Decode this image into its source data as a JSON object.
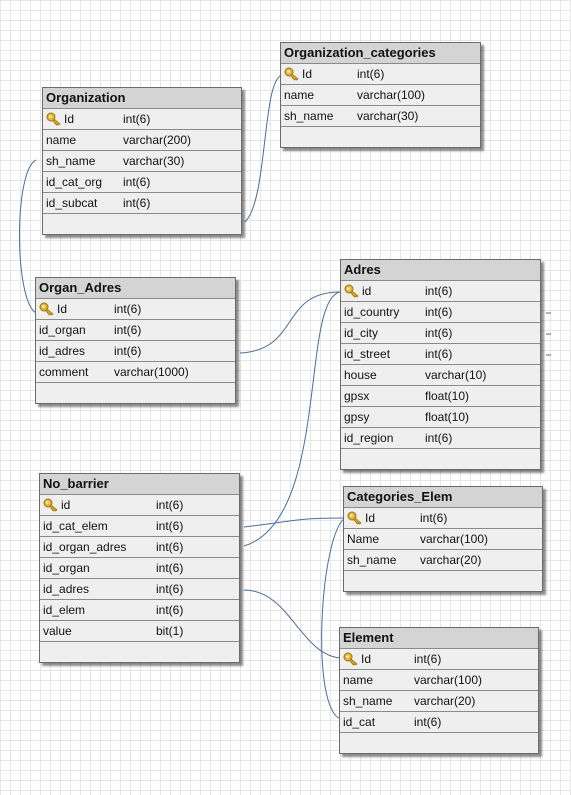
{
  "diagram": {
    "tables": [
      {
        "id": "organization",
        "title": "Organization",
        "columns": [
          {
            "name": "Id",
            "type": "int(6)",
            "pk": true
          },
          {
            "name": "name",
            "type": "varchar(200)"
          },
          {
            "name": "sh_name",
            "type": "varchar(30)"
          },
          {
            "name": "id_cat_org",
            "type": "int(6)"
          },
          {
            "name": "id_subcat",
            "type": "int(6)"
          }
        ]
      },
      {
        "id": "organization-categories",
        "title": "Organization_categories",
        "columns": [
          {
            "name": "Id",
            "type": "int(6)",
            "pk": true
          },
          {
            "name": "name",
            "type": "varchar(100)"
          },
          {
            "name": "sh_name",
            "type": "varchar(30)"
          }
        ]
      },
      {
        "id": "organ-adres",
        "title": "Organ_Adres",
        "columns": [
          {
            "name": "Id",
            "type": "int(6)",
            "pk": true
          },
          {
            "name": "id_organ",
            "type": "int(6)"
          },
          {
            "name": "id_adres",
            "type": "int(6)"
          },
          {
            "name": "comment",
            "type": "varchar(1000)"
          }
        ]
      },
      {
        "id": "adres",
        "title": "Adres",
        "columns": [
          {
            "name": "id",
            "type": "int(6)",
            "pk": true
          },
          {
            "name": "id_country",
            "type": "int(6)"
          },
          {
            "name": "id_city",
            "type": "int(6)"
          },
          {
            "name": "id_street",
            "type": "int(6)"
          },
          {
            "name": "house",
            "type": "varchar(10)"
          },
          {
            "name": "gpsx",
            "type": "float(10)"
          },
          {
            "name": "gpsy",
            "type": "float(10)"
          },
          {
            "name": "id_region",
            "type": "int(6)"
          }
        ]
      },
      {
        "id": "no-barrier",
        "title": "No_barrier",
        "columns": [
          {
            "name": "id",
            "type": "int(6)",
            "pk": true
          },
          {
            "name": "id_cat_elem",
            "type": "int(6)"
          },
          {
            "name": "id_organ_adres",
            "type": "int(6)"
          },
          {
            "name": "id_organ",
            "type": "int(6)"
          },
          {
            "name": "id_adres",
            "type": "int(6)"
          },
          {
            "name": "id_elem",
            "type": "int(6)"
          },
          {
            "name": "value",
            "type": "bit(1)"
          }
        ]
      },
      {
        "id": "categories-elem",
        "title": "Categories_Elem",
        "columns": [
          {
            "name": "Id",
            "type": "int(6)",
            "pk": true
          },
          {
            "name": "Name",
            "type": "varchar(100)"
          },
          {
            "name": "sh_name",
            "type": "varchar(20)"
          }
        ]
      },
      {
        "id": "element",
        "title": "Element",
        "columns": [
          {
            "name": "Id",
            "type": "int(6)",
            "pk": true
          },
          {
            "name": "name",
            "type": "varchar(100)"
          },
          {
            "name": "sh_name",
            "type": "varchar(20)"
          },
          {
            "name": "id_cat",
            "type": "int(6)"
          }
        ]
      }
    ],
    "colors": {
      "link": "#4a6e9a",
      "header": "#d4d4d4",
      "body": "#efefef",
      "key": "#d8a521"
    }
  }
}
